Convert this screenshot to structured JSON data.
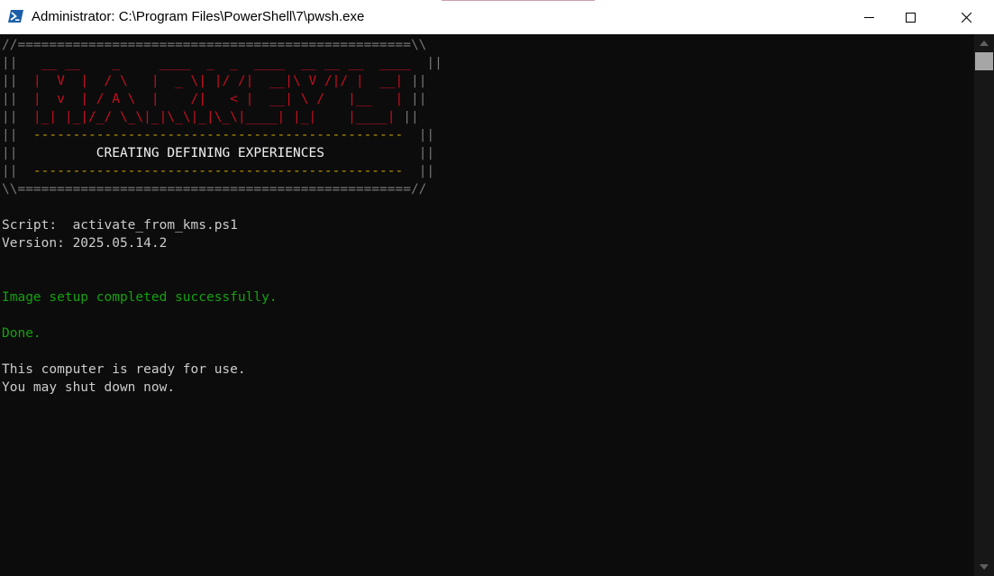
{
  "window": {
    "title": "Administrator: C:\\Program Files\\PowerShell\\7\\pwsh.exe",
    "icon": "powershell-icon",
    "controls": {
      "minimize": "minimize-icon",
      "maximize": "maximize-icon",
      "close": "close-icon"
    }
  },
  "colors": {
    "background": "#0c0c0c",
    "frame": "#767676",
    "logo": "#c50f1f",
    "dash": "#c19c00",
    "text": "#cccccc",
    "bright": "#f2f2f2",
    "success": "#13a10e"
  },
  "console": {
    "lines": [
      {
        "name": "banner-border-top",
        "segments": [
          {
            "text": "//==================================================\\\\",
            "style": "frame"
          }
        ]
      },
      {
        "name": "banner-logo-line-1",
        "segments": [
          {
            "text": "||",
            "style": "frame"
          },
          {
            "text": "   __ __    _     ____  _  _  ____  __ __ __  ____  ",
            "style": "logo"
          },
          {
            "text": "||",
            "style": "frame"
          }
        ]
      },
      {
        "name": "banner-logo-line-2",
        "segments": [
          {
            "text": "||",
            "style": "frame"
          },
          {
            "text": "  |  V  |  / \\   |  _ \\| |/ /|  __|\\ V /|/ |  __| ",
            "style": "logo"
          },
          {
            "text": "||",
            "style": "frame"
          }
        ]
      },
      {
        "name": "banner-logo-line-3",
        "segments": [
          {
            "text": "||",
            "style": "frame"
          },
          {
            "text": "  |  v  | / A \\  |    /|   < |  __| \\ /   |__   | ",
            "style": "logo"
          },
          {
            "text": "||",
            "style": "frame"
          }
        ]
      },
      {
        "name": "banner-logo-line-4",
        "segments": [
          {
            "text": "||",
            "style": "frame"
          },
          {
            "text": "  |_| |_|/_/ \\_\\|_|\\_\\|_|\\_\\|____| |_|    |____| ",
            "style": "logo"
          },
          {
            "text": "||",
            "style": "frame"
          }
        ]
      },
      {
        "name": "banner-dash-line-1",
        "segments": [
          {
            "text": "||",
            "style": "frame"
          },
          {
            "text": "  -----------------------------------------------  ",
            "style": "dash"
          },
          {
            "text": "||",
            "style": "frame"
          }
        ]
      },
      {
        "name": "banner-tagline",
        "segments": [
          {
            "text": "||",
            "style": "frame"
          },
          {
            "text": "          CREATING DEFINING EXPERIENCES            ",
            "style": "white"
          },
          {
            "text": "||",
            "style": "frame"
          }
        ]
      },
      {
        "name": "banner-dash-line-2",
        "segments": [
          {
            "text": "||",
            "style": "frame"
          },
          {
            "text": "  -----------------------------------------------  ",
            "style": "dash"
          },
          {
            "text": "||",
            "style": "frame"
          }
        ]
      },
      {
        "name": "banner-border-bottom",
        "segments": [
          {
            "text": "\\\\==================================================//",
            "style": "frame"
          }
        ]
      },
      {
        "name": "blank-line",
        "segments": []
      },
      {
        "name": "script-line",
        "segments": [
          {
            "text": "Script:  activate_from_kms.ps1",
            "style": "gray"
          }
        ]
      },
      {
        "name": "version-line",
        "segments": [
          {
            "text": "Version: 2025.05.14.2",
            "style": "gray"
          }
        ]
      },
      {
        "name": "blank-line",
        "segments": []
      },
      {
        "name": "blank-line",
        "segments": []
      },
      {
        "name": "success-line",
        "segments": [
          {
            "text": "Image setup completed successfully.",
            "style": "green"
          }
        ]
      },
      {
        "name": "blank-line",
        "segments": []
      },
      {
        "name": "done-line",
        "segments": [
          {
            "text": "Done.",
            "style": "green"
          }
        ]
      },
      {
        "name": "blank-line",
        "segments": []
      },
      {
        "name": "ready-line",
        "segments": [
          {
            "text": "This computer is ready for use.",
            "style": "gray"
          }
        ]
      },
      {
        "name": "shutdown-line",
        "segments": [
          {
            "text": "You may shut down now.",
            "style": "gray"
          }
        ]
      }
    ]
  },
  "scrollbar": {
    "up_icon": "scroll-up-arrow-icon",
    "down_icon": "scroll-down-arrow-icon"
  }
}
